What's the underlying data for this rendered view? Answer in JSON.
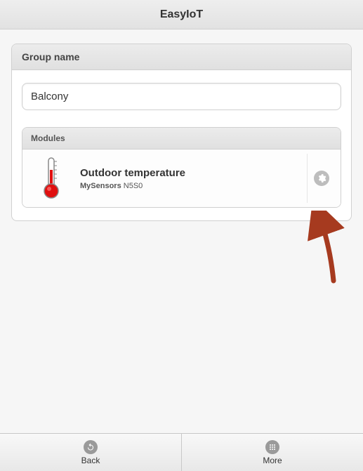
{
  "header": {
    "title": "EasyIoT"
  },
  "group": {
    "label": "Group name",
    "value": "Balcony"
  },
  "modules": {
    "label": "Modules",
    "items": [
      {
        "title": "Outdoor temperature",
        "provider": "MySensors",
        "address": "N5S0"
      }
    ]
  },
  "footer": {
    "back": "Back",
    "more": "More"
  }
}
